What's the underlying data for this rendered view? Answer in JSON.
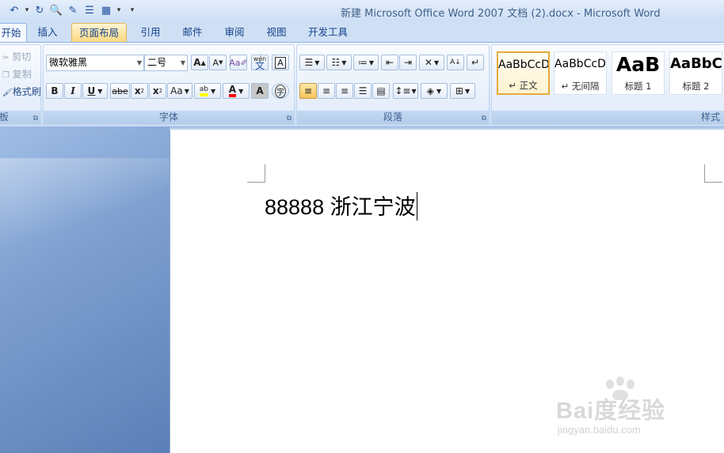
{
  "window": {
    "title": "新建 Microsoft Office Word 2007 文档 (2).docx - Microsoft Word"
  },
  "tabs": [
    {
      "label": "开始"
    },
    {
      "label": "插入"
    },
    {
      "label": "页面布局"
    },
    {
      "label": "引用"
    },
    {
      "label": "邮件"
    },
    {
      "label": "审阅"
    },
    {
      "label": "视图"
    },
    {
      "label": "开发工具"
    }
  ],
  "clipboard": {
    "cut": "剪切",
    "copy": "复制",
    "format_painter": "格式刷",
    "group_label": "板"
  },
  "font": {
    "name": "微软雅黑",
    "size": "二号",
    "grow": "A",
    "shrink": "A",
    "bold": "B",
    "italic": "I",
    "underline": "U",
    "strikethrough": "abe",
    "subscript": "x",
    "superscript": "x",
    "change_case": "Aa",
    "font_color": "A",
    "char_shading": "A",
    "clear": "A",
    "phonetic": "wén",
    "phonetic_char": "文",
    "enclose": "字",
    "group_label": "字体"
  },
  "paragraph": {
    "group_label": "段落"
  },
  "styles": {
    "items": [
      {
        "preview": "AaBbCcD",
        "name": "↵ 正文"
      },
      {
        "preview": "AaBbCcD",
        "name": "↵ 无间隔"
      },
      {
        "preview": "AaB",
        "name": "标题 1"
      },
      {
        "preview": "AaBbC",
        "name": "标题 2"
      }
    ],
    "group_label": "样式"
  },
  "document": {
    "text": "88888 浙江宁波"
  },
  "watermark": {
    "brand": "Bai度经验",
    "url": "jingyan.baidu.com"
  },
  "colors": {
    "highlight": "#ffff00",
    "font_color": "#ff0000",
    "accent": "#15428b"
  }
}
